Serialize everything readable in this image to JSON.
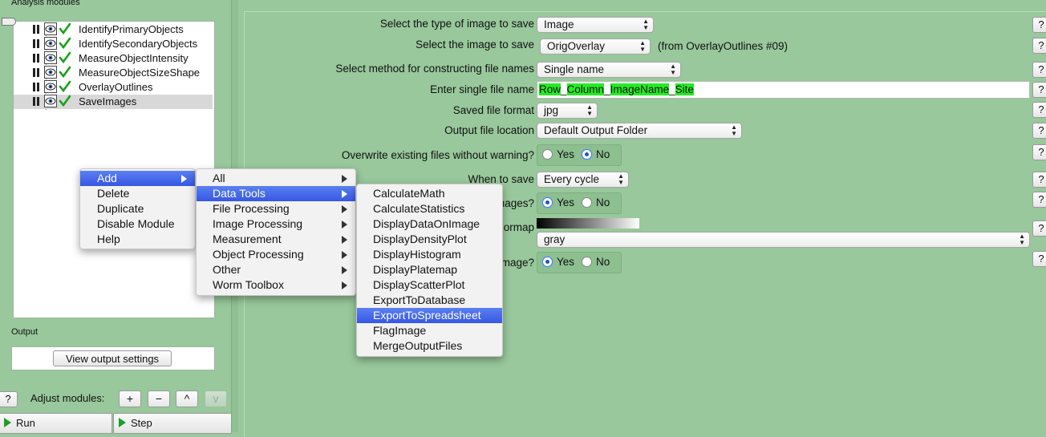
{
  "left_panel": {
    "analysis_label": "Analysis modules",
    "modules": [
      {
        "name": "IdentifyPrimaryObjects"
      },
      {
        "name": "IdentifySecondaryObjects"
      },
      {
        "name": "MeasureObjectIntensity"
      },
      {
        "name": "MeasureObjectSizeShape"
      },
      {
        "name": "OverlayOutlines"
      },
      {
        "name": "SaveImages",
        "selected": true
      }
    ],
    "output_label": "Output",
    "view_output_button": "View output settings",
    "help_button": "?",
    "adjust_label": "Adjust modules:",
    "adjust_buttons": [
      "+",
      "−",
      "^",
      "v"
    ],
    "run_button": "Run",
    "step_button": "Step"
  },
  "settings": {
    "image_type": {
      "label": "Select the type of image to save",
      "value": "Image"
    },
    "image_name": {
      "label": "Select the image to save",
      "value": "OrigOverlay",
      "note": "(from OverlayOutlines #09)"
    },
    "naming_method": {
      "label": "Select method for constructing file names",
      "value": "Single name"
    },
    "single_name": {
      "label": "Enter single file name",
      "parts": [
        "Row",
        "_",
        "Column",
        "_",
        "ImageName",
        "_",
        "Site"
      ]
    },
    "file_format": {
      "label": "Saved file format",
      "value": "jpg"
    },
    "output_location": {
      "label": "Output file location",
      "value": "Default Output Folder"
    },
    "overwrite": {
      "label": "Overwrite existing files without warning?",
      "yes": "Yes",
      "no": "No",
      "selected": "No"
    },
    "when_to_save": {
      "label": "When to save",
      "value": "Every cycle"
    },
    "record_images": {
      "label_visible": "mages?",
      "yes": "Yes",
      "no": "No",
      "selected": "Yes"
    },
    "colormap": {
      "label_visible": "ormap",
      "value": "gray"
    },
    "update_image": {
      "label_visible": "mage?",
      "yes": "Yes",
      "no": "No",
      "selected": "Yes"
    },
    "help_label": "?"
  },
  "context_menu": {
    "items": [
      "Add",
      "Delete",
      "Duplicate",
      "Disable Module",
      "Help"
    ],
    "active": "Add"
  },
  "add_submenu": {
    "items": [
      "All",
      "Data Tools",
      "File Processing",
      "Image Processing",
      "Measurement",
      "Object Processing",
      "Other",
      "Worm Toolbox"
    ],
    "active": "Data Tools"
  },
  "data_tools_submenu": {
    "items": [
      "CalculateMath",
      "CalculateStatistics",
      "DisplayDataOnImage",
      "DisplayDensityPlot",
      "DisplayHistogram",
      "DisplayPlatemap",
      "DisplayScatterPlot",
      "ExportToDatabase",
      "ExportToSpreadsheet",
      "FlagImage",
      "MergeOutputFiles"
    ],
    "active": "ExportToSpreadsheet"
  },
  "colors": {
    "panel_green": "#98c89b",
    "menu_highlight": "#3658e4",
    "filename_highlight": "#22ee22"
  }
}
